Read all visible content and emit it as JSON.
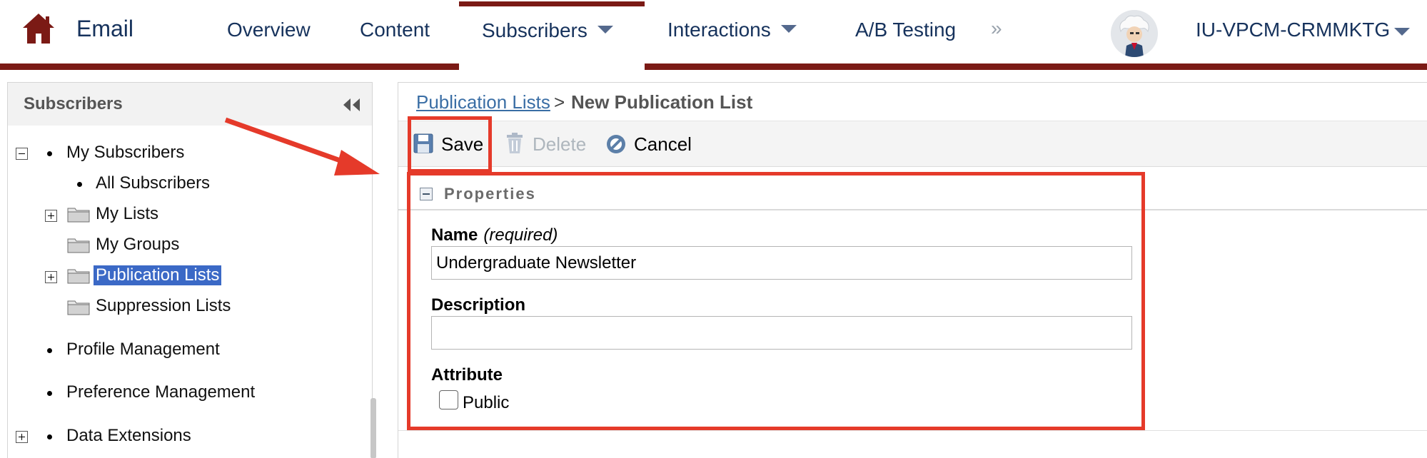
{
  "nav": {
    "app_name": "Email",
    "tabs": [
      {
        "label": "Overview"
      },
      {
        "label": "Content"
      },
      {
        "label": "Subscribers"
      },
      {
        "label": "Interactions"
      },
      {
        "label": "A/B Testing"
      }
    ],
    "more": "»",
    "org_name": "IU-VPCM-CRMMKTG",
    "brand_color": "#7b1a15",
    "icons": {
      "home": "home-icon",
      "avatar": "avatar"
    }
  },
  "sidebar": {
    "title": "Subscribers",
    "items": [
      {
        "label": "My Subscribers"
      },
      {
        "label": "All Subscribers"
      },
      {
        "label": "My Lists"
      },
      {
        "label": "My Groups"
      },
      {
        "label": "Publication Lists"
      },
      {
        "label": "Suppression Lists"
      },
      {
        "label": "Profile Management"
      },
      {
        "label": "Preference Management"
      },
      {
        "label": "Data Extensions"
      }
    ]
  },
  "main": {
    "breadcrumb": {
      "link": "Publication Lists",
      "separator": ">",
      "current": "New Publication List"
    },
    "toolbar": {
      "save": "Save",
      "delete": "Delete",
      "cancel": "Cancel"
    },
    "section": "Properties",
    "fields": {
      "name_label": "Name",
      "name_hint": "(required)",
      "name_value": "Undergraduate Newsletter",
      "description_label": "Description",
      "description_value": "",
      "attribute_label": "Attribute",
      "public_label": "Public",
      "public_checked": false
    }
  },
  "annotation_color": "#e53a2a"
}
